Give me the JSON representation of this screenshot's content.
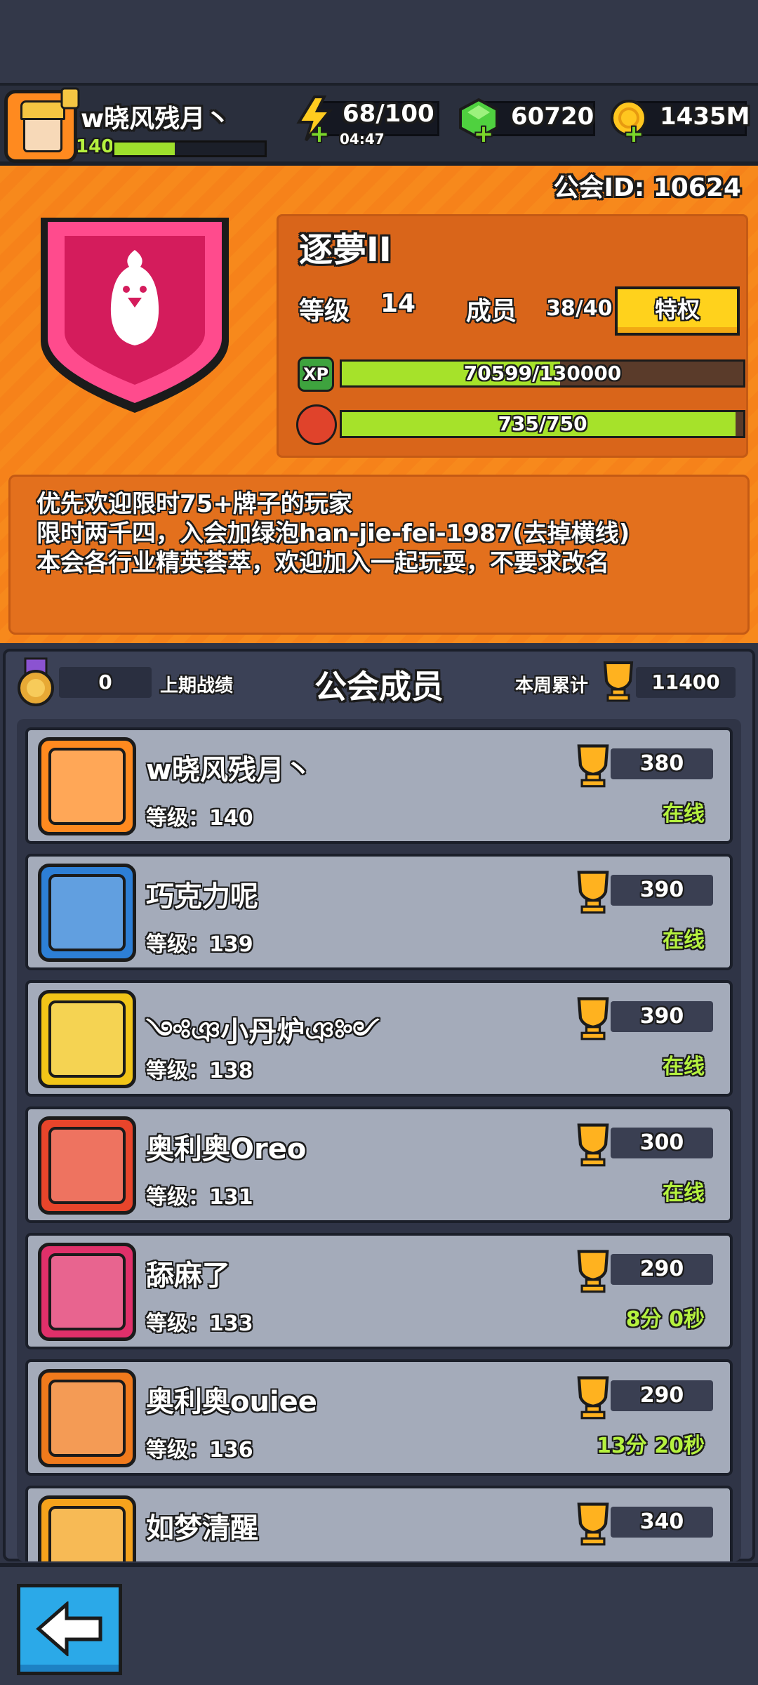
{
  "player": {
    "name": "w晓风残月丶",
    "level": "140",
    "xp_fraction": 0.4
  },
  "resources": {
    "energy": "68/100",
    "energy_timer": "04:47",
    "gems": "60720",
    "coins": "1435M"
  },
  "guild": {
    "id_label": "公会ID: 10624",
    "name": "逐夢II",
    "level_label": "等级",
    "level": "14",
    "members_label": "成员",
    "members": "38/40",
    "privilege_button": "特权",
    "xp_icon": "XP",
    "xp_text": "70599/130000",
    "xp_fraction": 0.543,
    "activity_text": "735/750",
    "activity_fraction": 0.98
  },
  "description": [
    "优先欢迎限时75+牌子的玩家",
    "限时两千四，入会加绿泡han-jie-fei-1987(去掉横线)",
    "本会各行业精英荟萃，欢迎加入一起玩耍，不要求改名"
  ],
  "members_header": {
    "last_record_value": "0",
    "last_record_label": "上期战绩",
    "title": "公会成员",
    "weekly_label": "本周累计",
    "weekly_value": "11400"
  },
  "members": [
    {
      "name": "w晓风残月丶",
      "level": "等级：140",
      "score": "380",
      "status": "在线",
      "avatar_color": "#ff8a1f"
    },
    {
      "name": "巧克力呢",
      "level": "等级：139",
      "score": "390",
      "status": "在线",
      "avatar_color": "#2d7fd6"
    },
    {
      "name": "༺ঞ小丹炉ঞ༻",
      "level": "等级：138",
      "score": "390",
      "status": "在线",
      "avatar_color": "#f2c518"
    },
    {
      "name": "奥利奥Oreo",
      "level": "等级：131",
      "score": "300",
      "status": "在线",
      "avatar_color": "#e8452b"
    },
    {
      "name": "舔麻了",
      "level": "等级：133",
      "score": "290",
      "status": "8分 0秒",
      "avatar_color": "#e0306a"
    },
    {
      "name": "奥利奥ouiee",
      "level": "等级：136",
      "score": "290",
      "status": "13分 20秒",
      "avatar_color": "#f07a1c"
    },
    {
      "name": "如梦清醒",
      "level": "",
      "score": "340",
      "status": "",
      "avatar_color": "#f5a31c"
    }
  ],
  "colors": {
    "orange_bg": "#f7891c",
    "row_bg": "#a4abba",
    "online_green": "#b5f13f",
    "privilege_yellow": "#ffd21c"
  },
  "icons": [
    "energy-icon",
    "gem-icon",
    "coin-icon",
    "chicken-guild-badge-icon",
    "trophy-icon",
    "medal-icon",
    "back-arrow-icon"
  ]
}
